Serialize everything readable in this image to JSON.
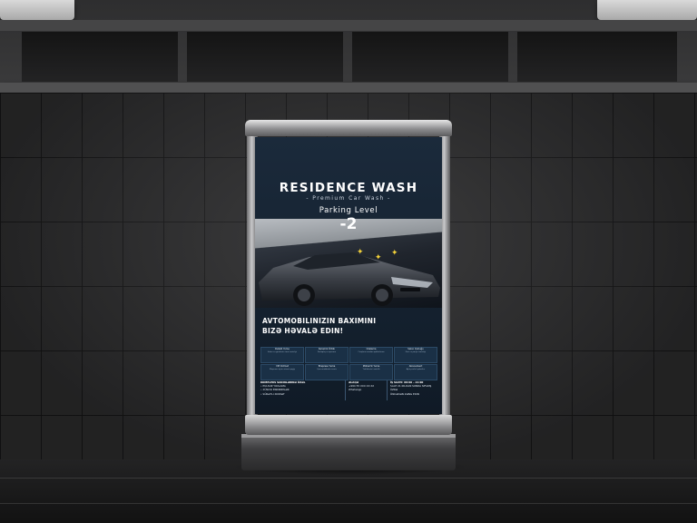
{
  "poster": {
    "title": "RESIDENCE WASH",
    "subtitle": "- Premium Car Wash -",
    "parking_label": "Parking Level",
    "parking_level": "-2",
    "tagline_line1": "AVTOMOBILINIZIN BAXIMINI",
    "tagline_line2": "BIZƏ HƏVALƏ EDIN!",
    "services": [
      {
        "title": "Detalli Yuma",
        "desc": "Salon və gövdənin tam təmizliyi"
      },
      {
        "title": "Keramik Örtük",
        "desc": "Parlaqlıq və qoruma"
      },
      {
        "title": "Cilalama",
        "desc": "Cızıqların aradan qaldırılması"
      },
      {
        "title": "Salon Qulluğu",
        "desc": "Dəri və parça təmizliyi"
      },
      {
        "title": "VIP Xidmət",
        "desc": "Maşınınız üçün xüsusi qayğı"
      },
      {
        "title": "Ekspress Yuma",
        "desc": "Qısa müddətdə təmiz"
      },
      {
        "title": "Mühərrik Yuma",
        "desc": "Təhlükəsiz təmizlik"
      },
      {
        "title": "Abonement",
        "desc": "Aylıq sərfəli paketlər"
      }
    ],
    "footer": {
      "col1_heading": "KOMPLEKS SAKINLƏRINƏ ÖZƏL",
      "col1_lines": [
        "• PULSUZ YOXLAMA",
        "• XÜSUSI ENDIRIMLƏR",
        "• SÜRƏTLI XIDMƏT"
      ],
      "col2_heading": "ƏLAQƏ",
      "col2_lines": [
        "+994 55 XXX XX XX",
        "WhatsApp"
      ],
      "col3_heading": "İŞ SAATI: 09:00 – 21:00",
      "col3_lines": [
        "SAAT 21:00-DAN SONRA SIFARIŞ ÜZRƏ",
        "ÖNCƏDƏN ZƏNG EDIN"
      ]
    }
  },
  "colors": {
    "poster_bg": "#14212f",
    "service_card": "#1a3046",
    "accent_spark": "#f3d23a",
    "frame_metal": "#c8c8ca"
  }
}
